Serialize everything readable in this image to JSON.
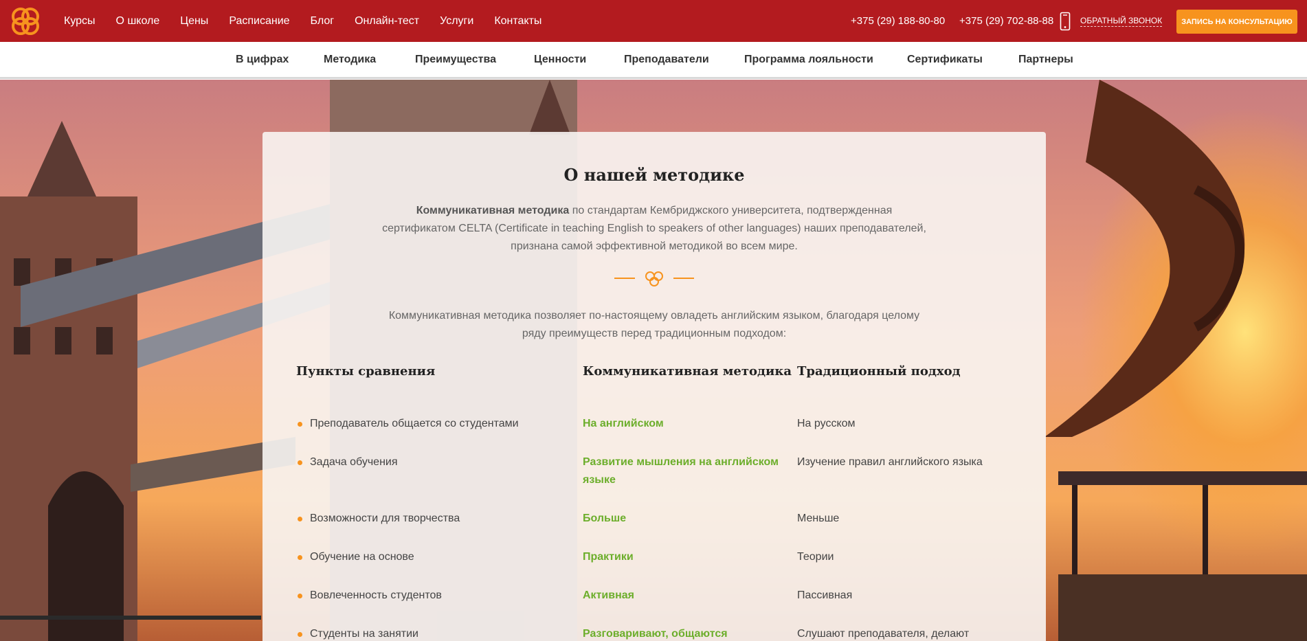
{
  "header": {
    "nav": [
      "Курсы",
      "О школе",
      "Цены",
      "Расписание",
      "Блог",
      "Онлайн-тест",
      "Услуги",
      "Контакты"
    ],
    "phone1": "+375 (29) 188-80-80",
    "phone2": "+375 (29) 702-88-88",
    "callback": "ОБРАТНЫЙ ЗВОНОК",
    "consult_button": "ЗАПИСЬ НА КОНСУЛЬТАЦИЮ"
  },
  "subnav": [
    "В цифрах",
    "Методика",
    "Преимущества",
    "Ценности",
    "Преподаватели",
    "Программа лояльности",
    "Сертификаты",
    "Партнеры"
  ],
  "section": {
    "title": "О нашей методике",
    "lead_bold": "Коммуникативная методика",
    "lead_line1_rest": " по стандартам Кембриджского университета, подтвержденная",
    "lead_line2": "сертификатом CELTA (Certificate in teaching English to speakers of other languages) наших преподавателей,",
    "lead_line3": "признана самой эффективной методикой во всем мире.",
    "lead2_line1": "Коммуникативная методика позволяет по-настоящему овладеть английским языком, благодаря целому",
    "lead2_line2": "ряду преимуществ перед традиционным подходом:",
    "columns": [
      "Пункты сравнения",
      "Коммуникативная методика",
      "Традиционный подход"
    ],
    "rows": [
      {
        "point": "Преподаватель общается со студентами",
        "communicative": "На английском",
        "traditional": "На русском"
      },
      {
        "point": "Задача обучения",
        "communicative": "Развитие мышления на английском языке",
        "traditional": "Изучение правил английского языка"
      },
      {
        "point": "Возможности для творчества",
        "communicative": "Больше",
        "traditional": "Меньше"
      },
      {
        "point": "Обучение на основе",
        "communicative": "Практики",
        "traditional": "Теории"
      },
      {
        "point": "Вовлеченность студентов",
        "communicative": "Активная",
        "traditional": "Пассивная"
      },
      {
        "point": "Студенты на занятии",
        "communicative": "Разговаривают, общаются",
        "traditional": "Слушают преподавателя, делают"
      }
    ]
  },
  "colors": {
    "header_red": "#b31b1f",
    "accent_orange": "#f7931e",
    "green": "#6cae2b"
  }
}
